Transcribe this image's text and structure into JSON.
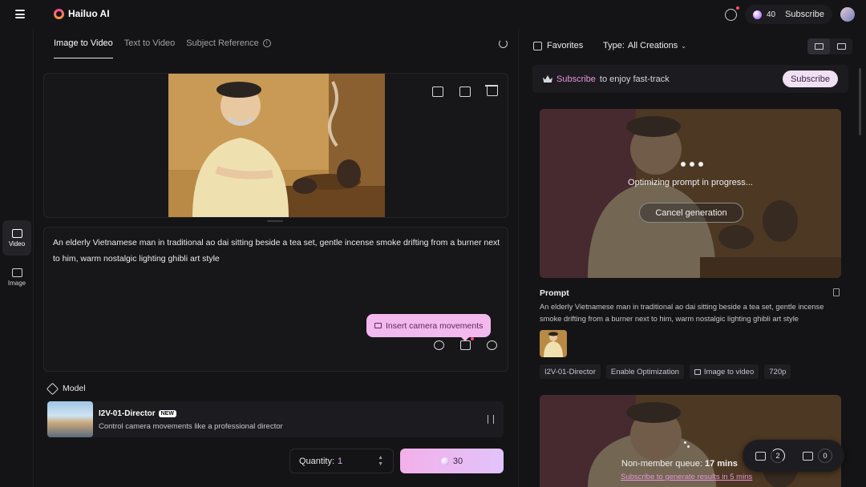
{
  "app": {
    "logo_text": "Hailuo AI",
    "credits": "40",
    "subscribe_label": "Subscribe"
  },
  "rail": {
    "items": [
      {
        "label": "Video",
        "active": true
      },
      {
        "label": "Image",
        "active": false
      }
    ]
  },
  "tabs": [
    {
      "label": "Image to Video",
      "active": true
    },
    {
      "label": "Text to Video",
      "active": false
    },
    {
      "label": "Subject Reference",
      "active": false
    }
  ],
  "info_glyph": "i",
  "prompt": {
    "text": "An elderly Vietnamese man in traditional ao dai sitting beside a tea set, gentle incense smoke drifting from a burner next to him, warm nostalgic lighting ghibli art style"
  },
  "tooltip": {
    "label": "Insert camera movements"
  },
  "model": {
    "section_label": "Model",
    "name": "I2V-01-Director",
    "badge": "NEW",
    "description": "Control camera movements like a professional director"
  },
  "generate": {
    "quantity_label": "Quantity:",
    "quantity_value": "1",
    "cost": "30"
  },
  "filters": {
    "favorites_label": "Favorites",
    "type_label": "Type:",
    "type_value": "All Creations"
  },
  "banner": {
    "link_text": "Subscribe",
    "rest_text": "to enjoy fast-track",
    "button_label": "Subscribe"
  },
  "task1": {
    "status_text": "Optimizing prompt in progress...",
    "cancel_label": "Cancel generation",
    "prompt_heading": "Prompt",
    "prompt_text": "An elderly Vietnamese man in traditional ao dai sitting beside a tea set, gentle incense smoke drifting from a burner next to him, warm nostalgic lighting ghibli art style",
    "tags": [
      "I2V-01-Director",
      "Enable Optimization",
      "Image to video",
      "720p"
    ]
  },
  "task2": {
    "queue_prefix": "Non-member queue: ",
    "queue_time": "17 mins",
    "link_text": "Subscribe to generate results in 5 mins"
  },
  "queue_pill": {
    "video_count": "2",
    "image_count": "0"
  },
  "colors": {
    "accent_pink": "#e993d9",
    "generate_gradient_start": "#f3b0ea",
    "background": "#141416"
  }
}
